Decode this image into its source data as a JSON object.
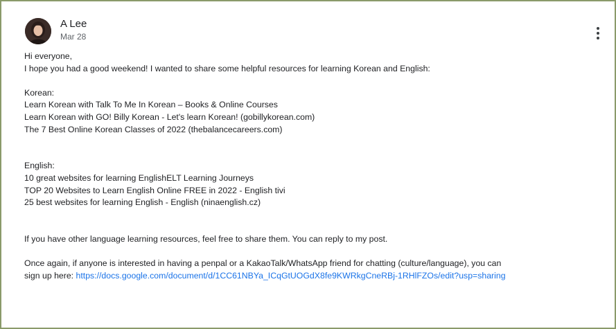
{
  "post": {
    "author": "A Lee",
    "date": "Mar 28",
    "more_icon": "more-vert-icon",
    "greeting": "Hi everyone,",
    "intro": "I hope you had a good weekend! I wanted to share some helpful resources for learning Korean and English:",
    "korean_heading": "Korean:",
    "korean_links": [
      "Learn Korean with Talk To Me In Korean – Books & Online Courses",
      "Learn Korean with GO! Billy Korean - Let's learn Korean! (gobillykorean.com)",
      "The 7 Best Online Korean Classes of 2022 (thebalancecareers.com)"
    ],
    "english_heading": "English:",
    "english_links": [
      "10 great websites for learning EnglishELT Learning Journeys",
      "TOP 20 Websites to Learn English Online FREE in 2022 - English tivi",
      "25 best websites for learning English - English (ninaenglish.cz)"
    ],
    "share_text": "If you have other language learning resources, feel free to share them. You can reply to my post.",
    "penpal_text": "Once again, if anyone is interested in having a penpal or a KakaoTalk/WhatsApp friend for chatting (culture/language), you can",
    "signup_text": "sign up here: ",
    "signup_url": "https://docs.google.com/document/d/1CC61NBYa_ICqGtUOGdX8fe9KWRkgCneRBj-1RHlFZOs/edit?usp=sharing"
  },
  "colors": {
    "border": "#8a9a6a",
    "link": "#1a73e8",
    "text": "#202124",
    "secondary": "#5f6368"
  }
}
